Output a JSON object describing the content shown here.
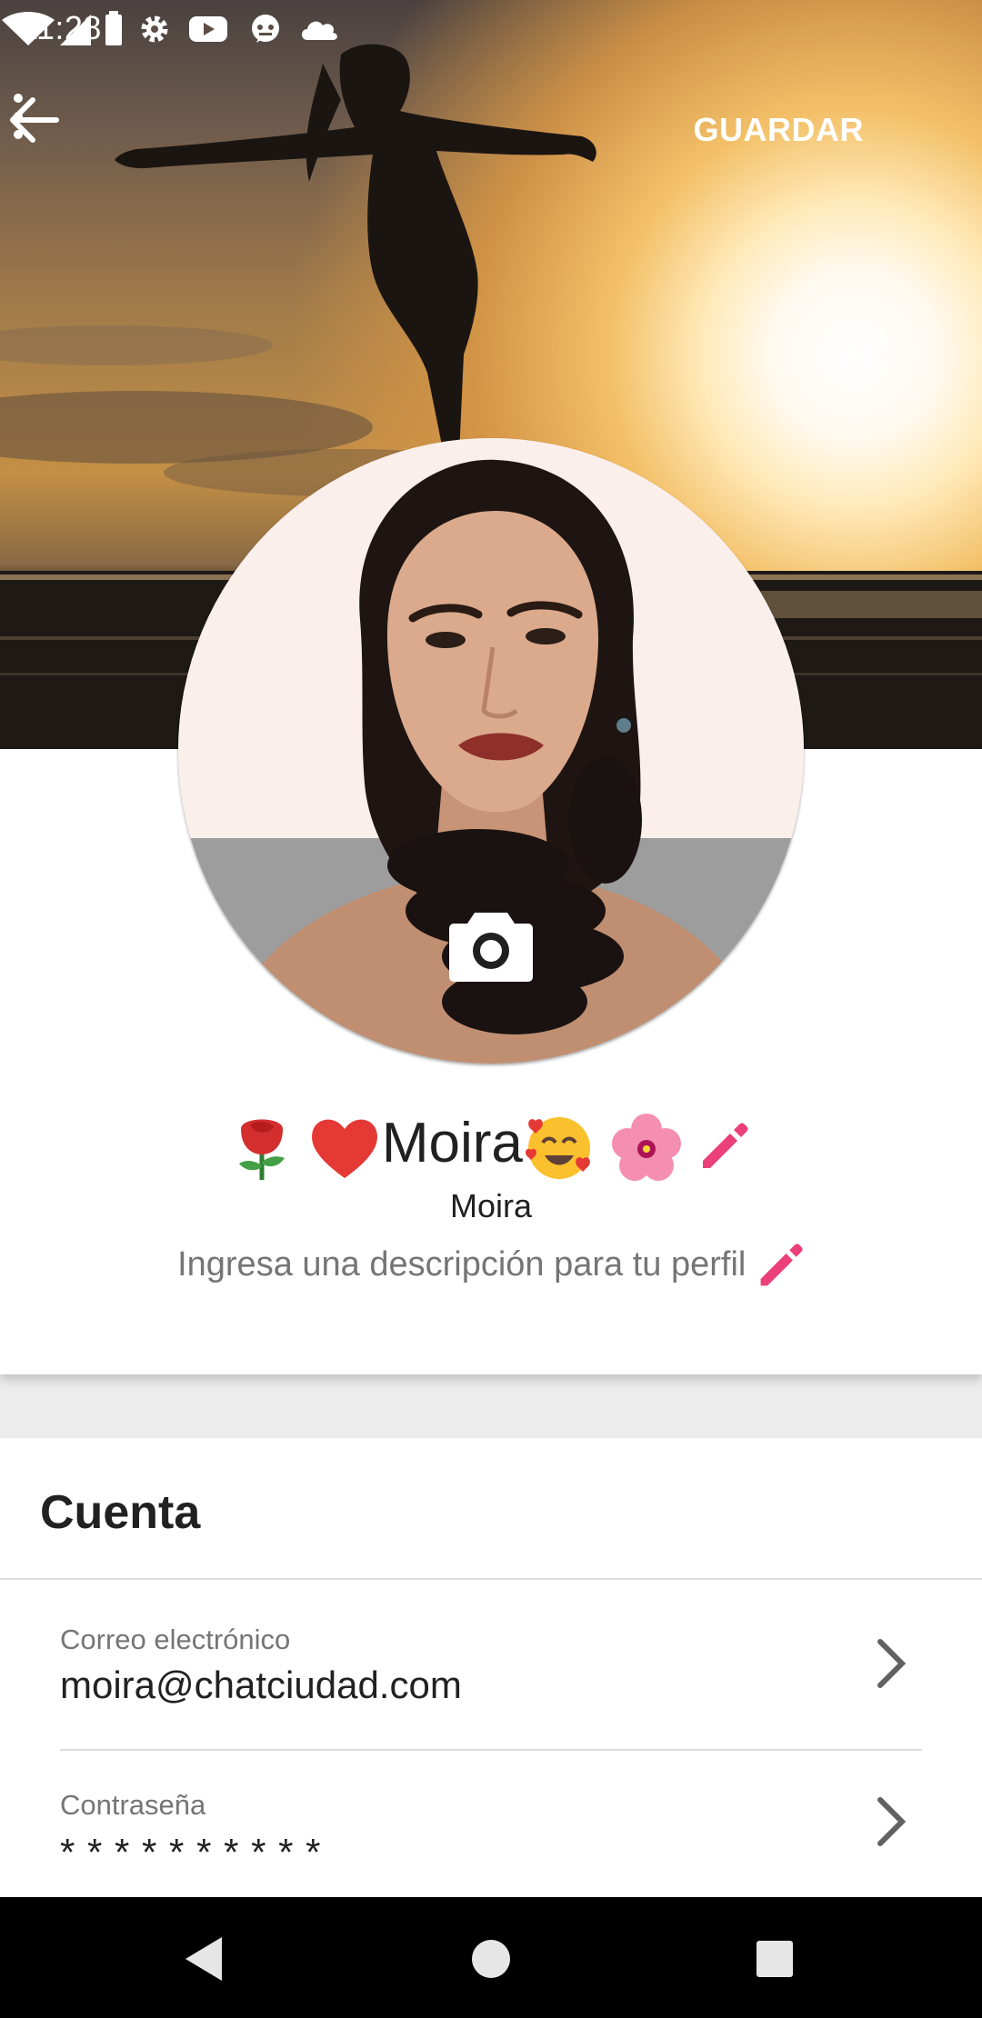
{
  "status_bar": {
    "time": "11:28",
    "icons": [
      "gear-icon",
      "youtube-icon",
      "messenger-icon",
      "cloud-icon",
      "wifi-icon",
      "signal-icon",
      "battery-icon"
    ]
  },
  "app_bar": {
    "back_icon": "arrow-back-icon",
    "save_label": "GUARDAR",
    "more_icon": "more-vert-icon"
  },
  "profile": {
    "display_name_prefix_emojis": [
      "rose-emoji",
      "heart-emoji"
    ],
    "display_name": "Moira",
    "display_name_suffix_emojis": [
      "smiling-face-with-hearts-emoji",
      "hibiscus-emoji"
    ],
    "username": "Moira",
    "description_placeholder": "Ingresa una descripción para tu perfil",
    "camera_icon": "camera-icon",
    "edit_icon": "pencil-icon",
    "accent_color": "#ec407a"
  },
  "account": {
    "title": "Cuenta",
    "rows": [
      {
        "label": "Correo electrónico",
        "value": "moira@chatciudad.com"
      },
      {
        "label": "Contraseña",
        "value": "* * * * * * * * * *"
      }
    ]
  },
  "nav_bar": {
    "icons": [
      "nav-back-icon",
      "nav-home-icon",
      "nav-recents-icon"
    ]
  }
}
